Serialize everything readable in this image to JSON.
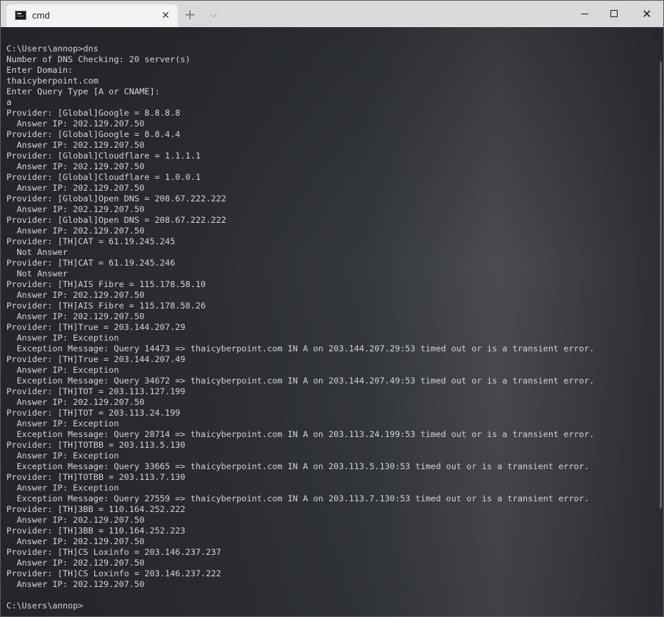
{
  "window": {
    "tab_title": "cmd",
    "tab_close_glyph": "✕",
    "new_tab_glyph": "+",
    "dropdown_glyph": "⌵",
    "close_glyph": "✕"
  },
  "terminal": {
    "lines": [
      "C:\\Users\\annop>dns",
      "Number of DNS Checking: 20 server(s)",
      "Enter Domain:",
      "thaicyberpoint.com",
      "Enter Query Type [A or CNAME]:",
      "a",
      "Provider: [Global]Google = 8.8.8.8",
      "  Answer IP: 202.129.207.50",
      "Provider: [Global]Google = 8.8.4.4",
      "  Answer IP: 202.129.207.50",
      "Provider: [Global]Cloudflare = 1.1.1.1",
      "  Answer IP: 202.129.207.50",
      "Provider: [Global]Cloudflare = 1.0.0.1",
      "  Answer IP: 202.129.207.50",
      "Provider: [Global]Open DNS = 208.67.222.222",
      "  Answer IP: 202.129.207.50",
      "Provider: [Global]Open DNS = 208.67.222.222",
      "  Answer IP: 202.129.207.50",
      "Provider: [TH]CAT = 61.19.245.245",
      "  Not Answer",
      "Provider: [TH]CAT = 61.19.245.246",
      "  Not Answer",
      "Provider: [TH]AIS Fibre = 115.178.58.10",
      "  Answer IP: 202.129.207.50",
      "Provider: [TH]AIS Fibre = 115.178.58.26",
      "  Answer IP: 202.129.207.50",
      "Provider: [TH]True = 203.144.207.29",
      "  Answer IP: Exception",
      "  Exception Message: Query 14473 => thaicyberpoint.com IN A on 203.144.207.29:53 timed out or is a transient error.",
      "Provider: [TH]True = 203.144.207.49",
      "  Answer IP: Exception",
      "  Exception Message: Query 34672 => thaicyberpoint.com IN A on 203.144.207.49:53 timed out or is a transient error.",
      "Provider: [TH]TOT = 203.113.127.199",
      "  Answer IP: 202.129.207.50",
      "Provider: [TH]TOT = 203.113.24.199",
      "  Answer IP: Exception",
      "  Exception Message: Query 28714 => thaicyberpoint.com IN A on 203.113.24.199:53 timed out or is a transient error.",
      "Provider: [TH]TOTBB = 203.113.5.130",
      "  Answer IP: Exception",
      "  Exception Message: Query 33665 => thaicyberpoint.com IN A on 203.113.5.130:53 timed out or is a transient error.",
      "Provider: [TH]TOTBB = 203.113.7.130",
      "  Answer IP: Exception",
      "  Exception Message: Query 27559 => thaicyberpoint.com IN A on 203.113.7.130:53 timed out or is a transient error.",
      "Provider: [TH]3BB = 110.164.252.222",
      "  Answer IP: 202.129.207.50",
      "Provider: [TH]3BB = 110.164.252.223",
      "  Answer IP: 202.129.207.50",
      "Provider: [TH]CS Loxinfo = 203.146.237.237",
      "  Answer IP: 202.129.207.50",
      "Provider: [TH]CS Loxinfo = 203.146.237.222",
      "  Answer IP: 202.129.207.50",
      "",
      "C:\\Users\\annop>"
    ]
  }
}
